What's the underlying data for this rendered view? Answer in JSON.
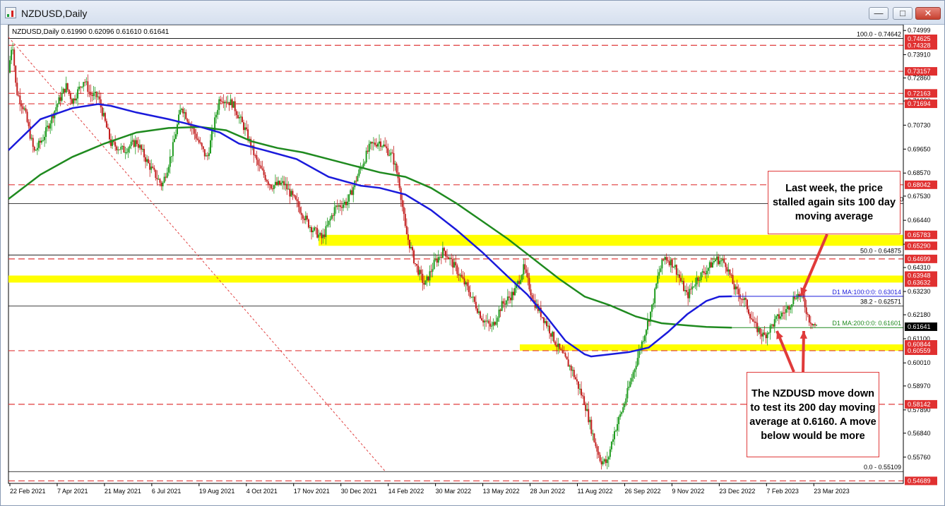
{
  "window": {
    "title": "NZDUSD,Daily",
    "minimize_glyph": "—",
    "maximize_glyph": "□",
    "close_glyph": "✕",
    "icon": "chart-app-icon"
  },
  "chart_data": {
    "type": "candlestick",
    "symbol_header": "NZDUSD,Daily  0.61990 0.62096 0.61610 0.61641",
    "ylim": [
      0.54689,
      0.74999
    ],
    "price_ticks": [
      "0.74999",
      "0.73910",
      "0.72860",
      "0.71820",
      "0.70730",
      "0.69650",
      "0.68570",
      "0.67530",
      "0.66440",
      "0.65360",
      "0.64310",
      "0.63230",
      "0.62180",
      "0.61100",
      "0.60010",
      "0.58970",
      "0.57890",
      "0.56840",
      "0.55760"
    ],
    "highlighted_levels": [
      "0.74625",
      "0.74328",
      "0.73157",
      "0.72163",
      "0.71694",
      "0.68042",
      "0.65783",
      "0.65290",
      "0.64699",
      "0.63948",
      "0.63632",
      "0.61641",
      "0.60844",
      "0.60559",
      "0.58142",
      "0.54689"
    ],
    "date_labels": [
      "22 Feb 2021",
      "7 Apr 2021",
      "21 May 2021",
      "6 Jul 2021",
      "19 Aug 2021",
      "4 Oct 2021",
      "17 Nov 2021",
      "30 Dec 2021",
      "14 Feb 2022",
      "30 Mar 2022",
      "13 May 2022",
      "28 Jun 2022",
      "11 Aug 2022",
      "26 Sep 2022",
      "9 Nov 2022",
      "23 Dec 2022",
      "7 Feb 2023",
      "23 Mar 2023"
    ],
    "line_labels": {
      "fib100": "100.0 - 0.74642",
      "fib50": "50.0 - 0.64875",
      "fib382": "38.2 - 0.62571",
      "fib0": "0.0 - 0.55109",
      "ma100": "D1 MA:100:0:0: 0.63014",
      "ma200": "D1 MA:200:0:0: 0.61601",
      "cut_label": "30"
    },
    "fib_levels": [
      0.74642,
      0.64875,
      0.62571,
      0.55109
    ],
    "extra_black_level": 0.6719,
    "support_levels": [
      0.74328,
      0.73157,
      0.72163,
      0.71694,
      0.68042,
      0.64699,
      0.60559,
      0.58142,
      0.54689
    ],
    "yellow_zones": [
      [
        0.6529,
        0.65783
      ],
      [
        0.63632,
        0.63948
      ],
      [
        0.60559,
        0.60844
      ]
    ],
    "ma100_value": 0.63014,
    "ma200_value": 0.61601,
    "current_price": 0.61641,
    "trendline": {
      "from": [
        0,
        0.747
      ],
      "to": [
        0.5888,
        0.55109
      ]
    },
    "price_path": [
      [
        0,
        0.731
      ],
      [
        0.006,
        0.746
      ],
      [
        0.012,
        0.723
      ],
      [
        0.025,
        0.714
      ],
      [
        0.04,
        0.695
      ],
      [
        0.055,
        0.702
      ],
      [
        0.075,
        0.716
      ],
      [
        0.09,
        0.725
      ],
      [
        0.1,
        0.718
      ],
      [
        0.118,
        0.728
      ],
      [
        0.128,
        0.721
      ],
      [
        0.14,
        0.72
      ],
      [
        0.16,
        0.699
      ],
      [
        0.18,
        0.696
      ],
      [
        0.2,
        0.7
      ],
      [
        0.22,
        0.689
      ],
      [
        0.24,
        0.68
      ],
      [
        0.255,
        0.695
      ],
      [
        0.27,
        0.716
      ],
      [
        0.29,
        0.704
      ],
      [
        0.31,
        0.692
      ],
      [
        0.33,
        0.72
      ],
      [
        0.35,
        0.717
      ],
      [
        0.37,
        0.705
      ],
      [
        0.39,
        0.689
      ],
      [
        0.41,
        0.68
      ],
      [
        0.43,
        0.681
      ],
      [
        0.45,
        0.672
      ],
      [
        0.47,
        0.662
      ],
      [
        0.49,
        0.656
      ],
      [
        0.51,
        0.67
      ],
      [
        0.53,
        0.673
      ],
      [
        0.55,
        0.688
      ],
      [
        0.565,
        0.698
      ],
      [
        0.58,
        0.7
      ],
      [
        0.6,
        0.693
      ],
      [
        0.61,
        0.682
      ],
      [
        0.62,
        0.66
      ],
      [
        0.635,
        0.645
      ],
      [
        0.65,
        0.635
      ],
      [
        0.665,
        0.645
      ],
      [
        0.68,
        0.651
      ],
      [
        0.7,
        0.642
      ],
      [
        0.72,
        0.632
      ],
      [
        0.74,
        0.62
      ],
      [
        0.755,
        0.616
      ],
      [
        0.77,
        0.626
      ],
      [
        0.79,
        0.632
      ],
      [
        0.805,
        0.643
      ],
      [
        0.82,
        0.628
      ],
      [
        0.84,
        0.618
      ],
      [
        0.86,
        0.606
      ],
      [
        0.88,
        0.597
      ],
      [
        0.9,
        0.582
      ],
      [
        0.915,
        0.565
      ],
      [
        0.925,
        0.556
      ],
      [
        0.935,
        0.555
      ],
      [
        0.945,
        0.568
      ],
      [
        0.96,
        0.58
      ],
      [
        0.975,
        0.595
      ],
      [
        0.99,
        0.61
      ],
      [
        1.005,
        0.625
      ],
      [
        1.015,
        0.64
      ],
      [
        1.025,
        0.648
      ],
      [
        1.04,
        0.644
      ],
      [
        1.06,
        0.63
      ],
      [
        1.075,
        0.638
      ],
      [
        1.09,
        0.642
      ],
      [
        1.105,
        0.647
      ],
      [
        1.12,
        0.645
      ],
      [
        1.135,
        0.633
      ],
      [
        1.15,
        0.628
      ],
      [
        1.165,
        0.617
      ],
      [
        1.18,
        0.612
      ],
      [
        1.2,
        0.62
      ],
      [
        1.215,
        0.624
      ],
      [
        1.23,
        0.631
      ],
      [
        1.24,
        0.63
      ],
      [
        1.25,
        0.62
      ],
      [
        1.262,
        0.6164
      ]
    ],
    "ma100_path": [
      [
        0,
        0.696
      ],
      [
        0.05,
        0.71
      ],
      [
        0.1,
        0.715
      ],
      [
        0.14,
        0.7168
      ],
      [
        0.16,
        0.716
      ],
      [
        0.2,
        0.713
      ],
      [
        0.25,
        0.71
      ],
      [
        0.3,
        0.7065
      ],
      [
        0.33,
        0.704
      ],
      [
        0.36,
        0.699
      ],
      [
        0.4,
        0.696
      ],
      [
        0.45,
        0.692
      ],
      [
        0.5,
        0.684
      ],
      [
        0.55,
        0.68
      ],
      [
        0.58,
        0.679
      ],
      [
        0.62,
        0.676
      ],
      [
        0.66,
        0.669
      ],
      [
        0.7,
        0.66
      ],
      [
        0.74,
        0.65
      ],
      [
        0.78,
        0.639
      ],
      [
        0.81,
        0.631
      ],
      [
        0.84,
        0.621
      ],
      [
        0.87,
        0.61
      ],
      [
        0.9,
        0.604
      ],
      [
        0.91,
        0.603
      ],
      [
        0.94,
        0.604
      ],
      [
        0.97,
        0.605
      ],
      [
        1.0,
        0.607
      ],
      [
        1.03,
        0.614
      ],
      [
        1.06,
        0.622
      ],
      [
        1.09,
        0.628
      ],
      [
        1.11,
        0.63
      ],
      [
        1.13,
        0.6301
      ]
    ],
    "ma200_path": [
      [
        0,
        0.674
      ],
      [
        0.05,
        0.685
      ],
      [
        0.1,
        0.693
      ],
      [
        0.15,
        0.699
      ],
      [
        0.2,
        0.704
      ],
      [
        0.25,
        0.706
      ],
      [
        0.3,
        0.7065
      ],
      [
        0.34,
        0.705
      ],
      [
        0.38,
        0.7
      ],
      [
        0.42,
        0.697
      ],
      [
        0.46,
        0.695
      ],
      [
        0.5,
        0.692
      ],
      [
        0.54,
        0.689
      ],
      [
        0.58,
        0.686
      ],
      [
        0.62,
        0.684
      ],
      [
        0.66,
        0.679
      ],
      [
        0.7,
        0.672
      ],
      [
        0.74,
        0.664
      ],
      [
        0.78,
        0.656
      ],
      [
        0.82,
        0.647
      ],
      [
        0.86,
        0.638
      ],
      [
        0.9,
        0.63
      ],
      [
        0.94,
        0.626
      ],
      [
        0.98,
        0.621
      ],
      [
        1.02,
        0.618
      ],
      [
        1.06,
        0.617
      ],
      [
        1.09,
        0.6163
      ],
      [
        1.13,
        0.616
      ]
    ]
  },
  "annotations": {
    "top_callout": "Last week, the price stalled again sits 100 day moving average",
    "bottom_callout": "The NZDUSD move down to test its 200 day moving average at 0.6160. A move below would be more"
  },
  "colors": {
    "red_level": "#e03b3b",
    "yellow_zone": "#ffff00",
    "ma100": "#1a1adb",
    "ma200": "#1f8a1f",
    "bull": "#1f9b1f",
    "bear": "#c32020",
    "trend": "#e04040"
  }
}
